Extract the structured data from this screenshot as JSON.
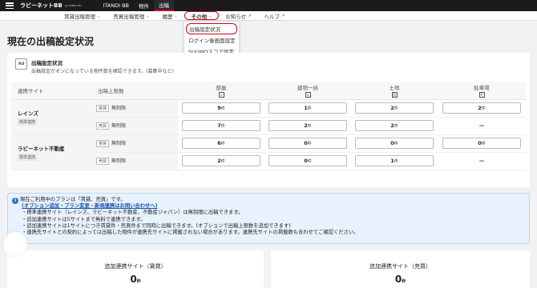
{
  "topbar": {
    "logo": "ラビーネットBB",
    "logo_sub": "by ITANDI INC.",
    "tabs": [
      "ITANDI BB",
      "物件",
      "出稿"
    ]
  },
  "subnav": {
    "items": [
      "賃貸出稿管理",
      "売買出稿管理",
      "履歴",
      "その他",
      "お知らせ",
      "ヘルプ"
    ]
  },
  "dropdown": {
    "items": [
      "出稿設定状況",
      "ログイン後画面設定",
      "SUUMOスコア設定"
    ]
  },
  "page_title": "現在の出稿設定状況",
  "card": {
    "icon": "Ad",
    "title": "出稿設定状況",
    "desc": "出稿設定がオンになっている物件数を確認できます。(募集中など)"
  },
  "table": {
    "headers": [
      "連携サイト",
      "出稿上限数",
      "部屋",
      "建物一括",
      "土地",
      "駐車場"
    ],
    "unit": "件",
    "rows": [
      {
        "site": "レインズ",
        "badge": "標準連携",
        "type": "賃貸",
        "limit": "無制限",
        "values": [
          "9",
          "1",
          "2",
          "2"
        ]
      },
      {
        "site": "",
        "badge": "",
        "type": "売買",
        "limit": "無制限",
        "values": [
          "7",
          "2",
          "2",
          "—"
        ]
      },
      {
        "site": "ラビーネット不動産",
        "badge": "標準連携",
        "type": "賃貸",
        "limit": "無制限",
        "values": [
          "6",
          "0",
          "0",
          "0"
        ]
      },
      {
        "site": "",
        "badge": "",
        "type": "売買",
        "limit": "無制限",
        "values": [
          "2",
          "0",
          "1",
          "—"
        ]
      }
    ]
  },
  "notice": {
    "line0": "現在ご利用中のプランは「賃貸、売買」です。",
    "link": "(オプション追加・プラン変更・新規連携はお問い合わせへ)",
    "bullets": [
      "・標準連携サイト（レインズ、ラビーネット不動産、不動産ジャパン）は無制限に出稿できます。",
      "・追加連携サイトは5サイトまで無料で連携できます。",
      "・追加連携サイトは1サイトにつき賃貸件・売買件まで同時に出稿できます。(オプションで出稿上限数を追加できます)",
      "・連携先サイトとの契約によっては出稿した物件が連携先サイトに掲載されない場合があります。連携先サイトの掲載数も合わせてご確認ください。"
    ]
  },
  "bottom": [
    {
      "title": "追加連携サイト（賃貸）",
      "value": "0",
      "unit": "枠"
    },
    {
      "title": "追加連携サイト（売買）",
      "value": "0",
      "unit": "枠"
    }
  ],
  "colors": {
    "accent": "#d0021b",
    "topbar": "#1b1b1d",
    "notice_bg": "#e8f2fd"
  }
}
